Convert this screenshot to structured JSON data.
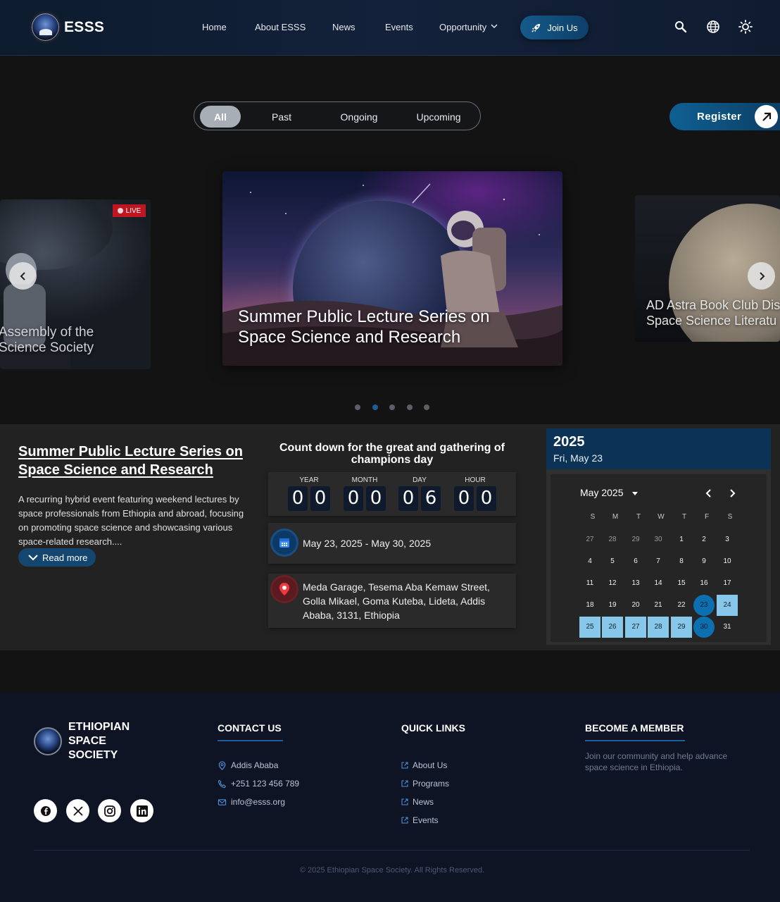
{
  "nav": {
    "brand": "ESSS",
    "links": [
      "Home",
      "About ESSS",
      "News",
      "Events",
      "Opportunity"
    ],
    "join_label": "Join Us"
  },
  "filter": {
    "tabs": [
      "All",
      "Past",
      "Ongoing",
      "Upcoming"
    ],
    "active": "All"
  },
  "register_label": "Register",
  "carousel": {
    "live_label": "LIVE",
    "slides": [
      "Assembly of the\nScience Society",
      "Summer Public Lecture Series on Space Science and Research",
      "AD Astra Book Club Dis\nSpace Science Literatu"
    ],
    "active_index": 1,
    "dot_count": 5
  },
  "event": {
    "title": "Summer Public Lecture Series on Space Science and Research",
    "description": "A recurring hybrid event featuring weekend lectures by space professionals from Ethiopia and abroad, focusing on promoting space science and showcasing various space-related research....",
    "read_more": "Read more",
    "countdown_title": "Count down for the great and gathering of champions day",
    "countdown": [
      {
        "label": "YEAR",
        "digits": [
          "0",
          "0"
        ]
      },
      {
        "label": "MONTH",
        "digits": [
          "0",
          "0"
        ]
      },
      {
        "label": "DAY",
        "digits": [
          "0",
          "6"
        ]
      },
      {
        "label": "HOUR",
        "digits": [
          "0",
          "0"
        ]
      }
    ],
    "date_range": "May 23, 2025 - May 30, 2025",
    "location": "Meda Garage, Tesema Aba Kemaw Street, Golla Mikael, Goma Kuteba, Lideta, Addis Ababa, 3131, Ethiopia"
  },
  "calendar": {
    "year": "2025",
    "selected_label": "Fri, May 23",
    "month_label": "May 2025",
    "weekdays": [
      "S",
      "M",
      "T",
      "W",
      "T",
      "F",
      "S"
    ],
    "weeks": [
      [
        "27",
        "28",
        "29",
        "30",
        "1",
        "2",
        "3"
      ],
      [
        "4",
        "5",
        "6",
        "7",
        "8",
        "9",
        "10"
      ],
      [
        "11",
        "12",
        "13",
        "14",
        "15",
        "16",
        "17"
      ],
      [
        "18",
        "19",
        "20",
        "21",
        "22",
        "23",
        "24"
      ],
      [
        "25",
        "26",
        "27",
        "28",
        "29",
        "30",
        "31"
      ]
    ],
    "range_start": "23",
    "range_end": "30"
  },
  "footer": {
    "org_name": "ETHIOPIAN\nSPACE\nSOCIETY",
    "contact_heading": "CONTACT US",
    "contact": [
      "Addis Ababa",
      "+251 123 456 789",
      "info@esss.org"
    ],
    "quick_heading": "QUICK LINKS",
    "quick_links": [
      "About Us",
      "Programs",
      "News",
      "Events"
    ],
    "member_heading": "BECOME A MEMBER",
    "member_text": "Join our community and help advance space science in Ethiopia.",
    "copyright": "© 2025 Ethiopian Space Society. All Rights Reserved."
  },
  "colors": {
    "accent": "#1d5d9b",
    "nav_bg": "#13213a",
    "live_red": "#c01622",
    "range_blue": "#87c7e9"
  }
}
